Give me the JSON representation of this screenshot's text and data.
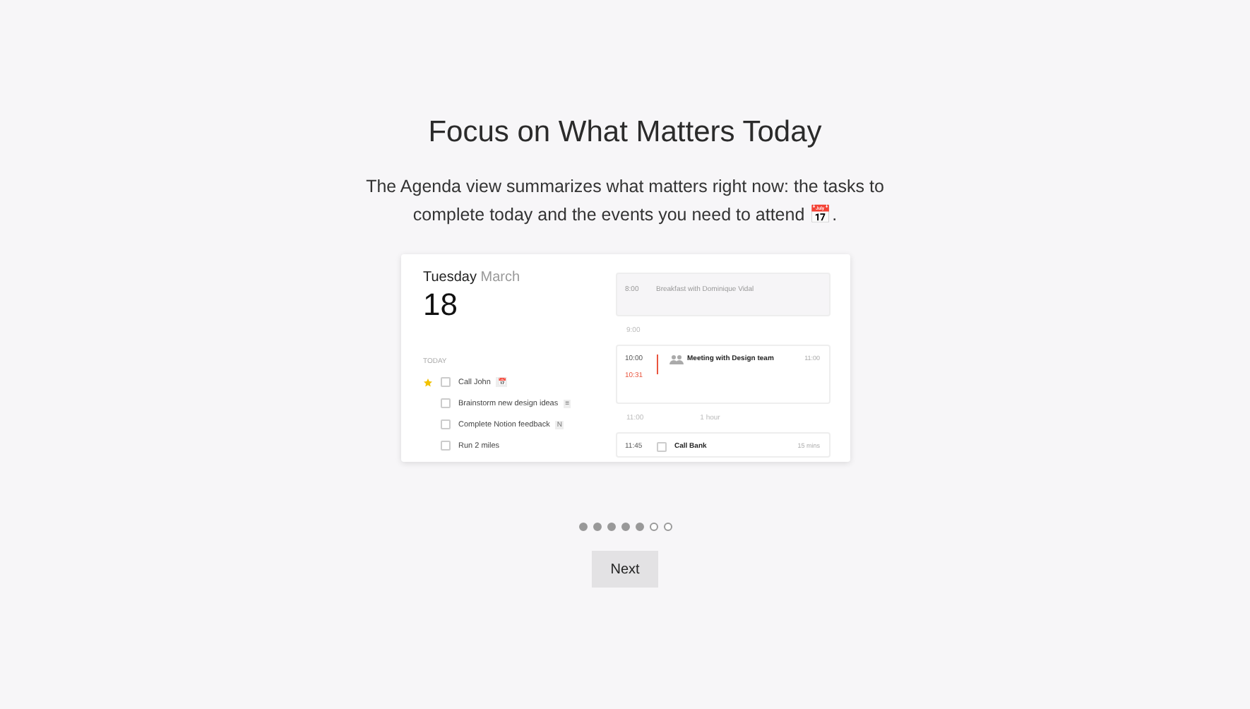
{
  "title": "Focus on What Matters Today",
  "description": "The Agenda view summarizes what matters right now: the tasks to complete today and the events you need to attend 📅.",
  "preview": {
    "weekday": "Tuesday",
    "month": "March",
    "day": "18",
    "section_label": "TODAY",
    "tasks": [
      {
        "label": "Call John",
        "starred": true,
        "checked": false,
        "tag": "📅"
      },
      {
        "label": "Brainstorm new design ideas",
        "starred": false,
        "checked": false,
        "tag": "≡"
      },
      {
        "label": "Complete Notion feedback",
        "starred": false,
        "checked": false,
        "tag": "N"
      },
      {
        "label": "Run 2 miles",
        "starred": false,
        "checked": false
      }
    ],
    "agenda": [
      {
        "kind": "event",
        "time": "8:00",
        "title": "Breakfast with Dominique Vidal",
        "faded": true
      },
      {
        "kind": "gap",
        "time": "9:00"
      },
      {
        "kind": "event",
        "time": "10:00",
        "now": "10:31",
        "title": "Meeting with Design team",
        "end": "11:00",
        "faded": false
      },
      {
        "kind": "gap",
        "time": "11:00",
        "duration": "1 hour"
      },
      {
        "kind": "task",
        "time": "11:45",
        "title": "Call Bank",
        "end": "15 mins",
        "faded": false,
        "checked": false
      }
    ]
  },
  "steps": [
    {
      "filled": true
    },
    {
      "filled": true
    },
    {
      "filled": true
    },
    {
      "filled": true
    },
    {
      "filled": true
    },
    {
      "filled": false
    },
    {
      "filled": false
    }
  ],
  "next_button": "Next"
}
